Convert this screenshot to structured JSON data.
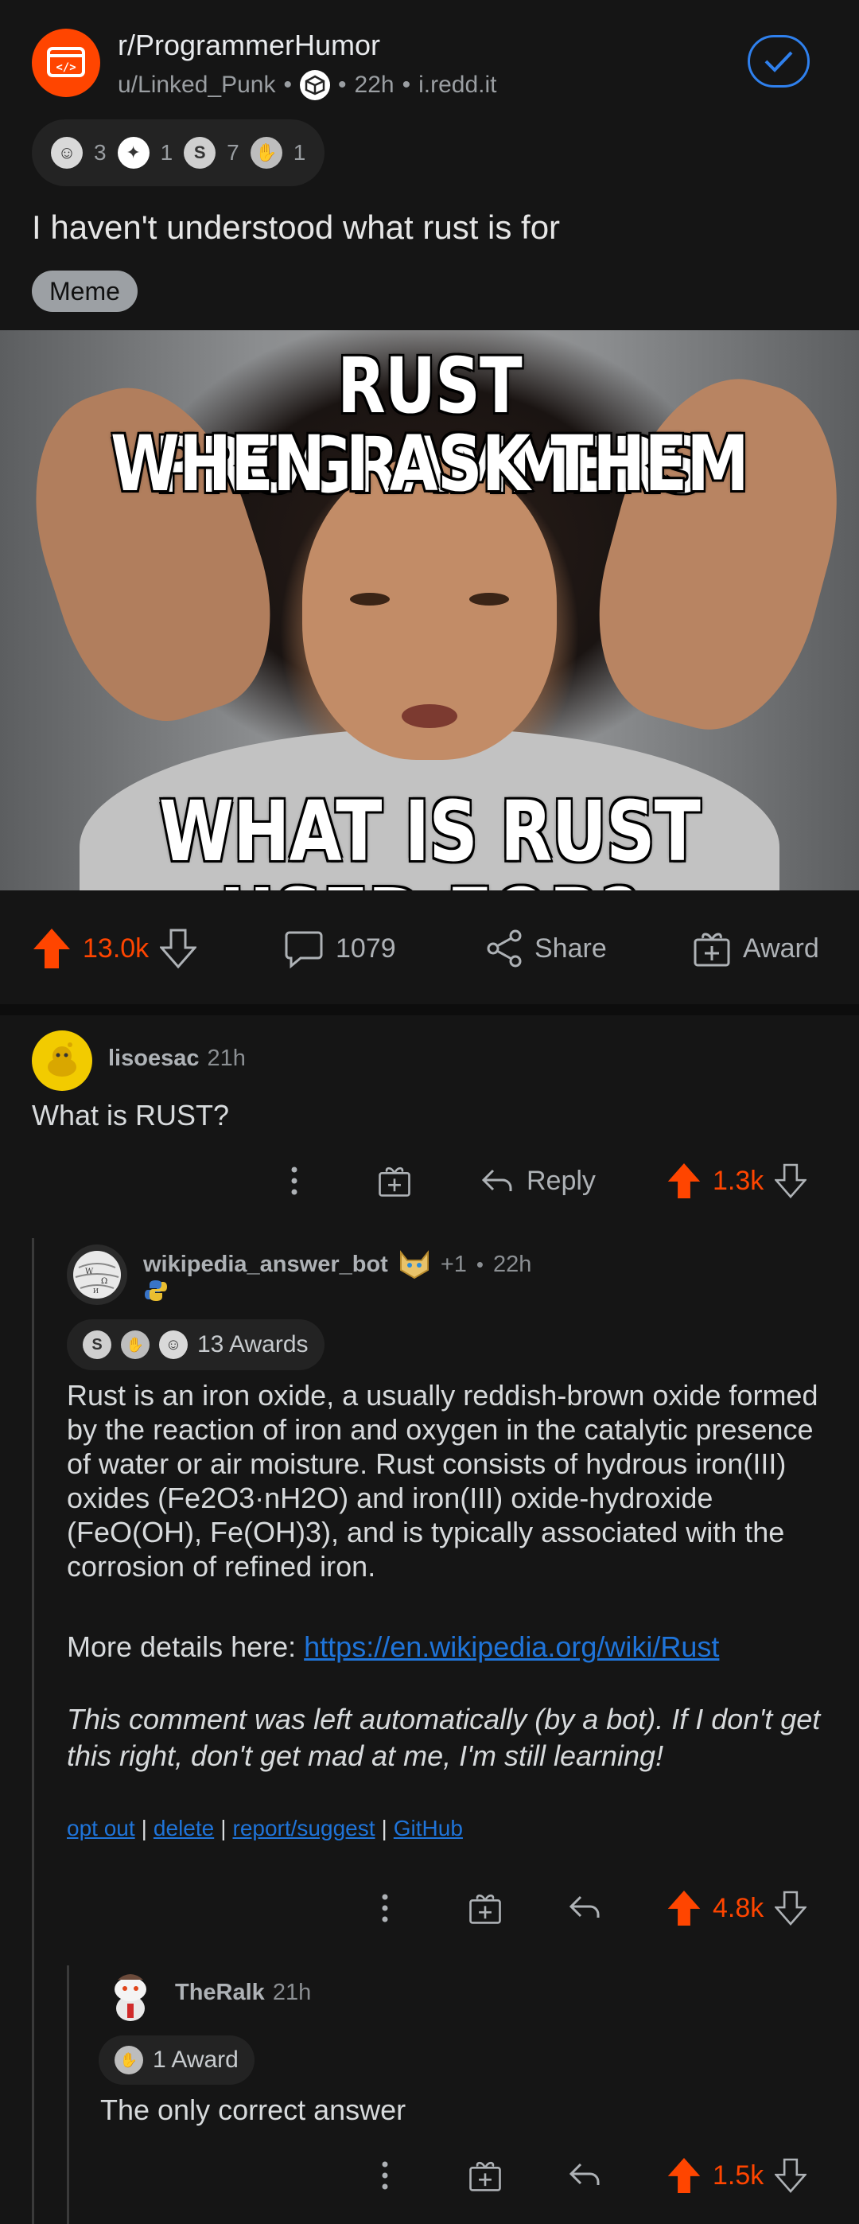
{
  "post": {
    "subreddit": "r/ProgrammerHumor",
    "author": "u/Linked_Punk",
    "age": "22h",
    "domain": "i.redd.it",
    "meta_sep": "•",
    "awards": [
      {
        "icon": "wholesome-award-icon",
        "count": "3"
      },
      {
        "icon": "helpful-award-icon",
        "count": "1"
      },
      {
        "icon": "silver-award-icon",
        "count": "7"
      },
      {
        "icon": "take-my-energy-award-icon",
        "count": "1"
      }
    ],
    "title": "I haven't understood what rust is for",
    "flair": "Meme",
    "meme": {
      "top_line1": "RUST PROGRAMMERS",
      "top_line2": "WHEN I ASK THEM",
      "bottom": "WHAT IS RUST USED FOR?"
    },
    "actions": {
      "votes": "13.0k",
      "comments": "1079",
      "share": "Share",
      "award": "Award"
    }
  },
  "comments": [
    {
      "user": "lisoesac",
      "time": "21h",
      "body": "What is RUST?",
      "reply": "Reply",
      "votes": "1.3k"
    },
    {
      "user": "wikipedia_answer_bot",
      "karma_badge": "+1",
      "time": "22h",
      "awards_label": "13 Awards",
      "body_p1": "Rust is an iron oxide, a usually reddish-brown oxide formed by the reaction of iron and oxygen in the catalytic presence of water or air moisture. Rust consists of hydrous iron(III) oxides (Fe2O3·nH2O) and iron(III) oxide-hydroxide (FeO(OH), Fe(OH)3), and is typically associated with the corrosion of refined iron.",
      "more_details": "More details here: ",
      "link": "https://en.wikipedia.org/wiki/Rust",
      "italic": "This comment was left automatically (by a bot). If I don't get this right, don't get mad at me, I'm still learning!",
      "footer_links": [
        "opt out",
        "delete",
        "report/suggest",
        "GitHub"
      ],
      "footer_sep": "|",
      "votes": "4.8k"
    },
    {
      "user": "TheRalk",
      "time": "21h",
      "awards_label": "1 Award",
      "body": "The only correct answer",
      "votes": "1.5k"
    }
  ],
  "colors": {
    "accent": "#ff4500",
    "link": "#1f74d9",
    "background": "#151515"
  }
}
